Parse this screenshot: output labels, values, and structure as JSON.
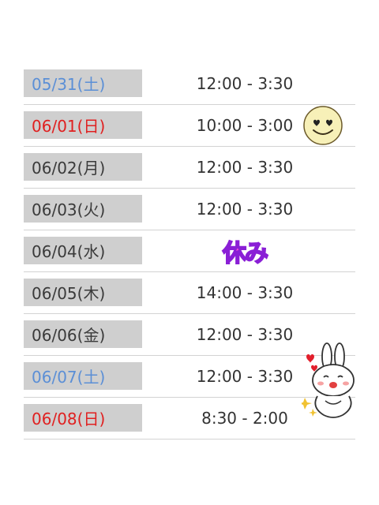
{
  "schedule": [
    {
      "date": "05/31(土)",
      "date_color": "blue",
      "time": "12:00 - 3:30"
    },
    {
      "date": "06/01(日)",
      "date_color": "red",
      "time": "10:00 - 3:00"
    },
    {
      "date": "06/02(月)",
      "date_color": "dark",
      "time": "12:00 - 3:30"
    },
    {
      "date": "06/03(火)",
      "date_color": "dark",
      "time": "12:00 - 3:30"
    },
    {
      "date": "06/04(水)",
      "date_color": "dark",
      "time": "休み",
      "holiday": true
    },
    {
      "date": "06/05(木)",
      "date_color": "dark",
      "time": "14:00 - 3:30"
    },
    {
      "date": "06/06(金)",
      "date_color": "dark",
      "time": "12:00 - 3:30"
    },
    {
      "date": "06/07(土)",
      "date_color": "blue",
      "time": "12:00 - 3:30"
    },
    {
      "date": "06/08(日)",
      "date_color": "red",
      "time": "8:30 - 2:00"
    }
  ],
  "stickers": {
    "smiley": "heart-eyes-smiley-icon",
    "bunny": "bunny-heart-sticker-icon"
  },
  "colors": {
    "weekday": "#3a3a3a",
    "saturday": "#5b8fd6",
    "sunday": "#e02020",
    "date_bg": "#cfcfcf",
    "holiday_fill": "#f04bd3",
    "holiday_outline": "#8a1fd6"
  }
}
